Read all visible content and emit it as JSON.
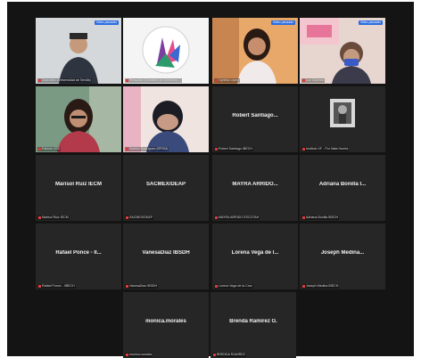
{
  "tiles": [
    {
      "name": "",
      "label": "Juan Aleo (Universidad de Sevilla)",
      "tag": "Video pausado",
      "video": "man"
    },
    {
      "name": "",
      "label": "Personas (Comisión de Derechos...)",
      "tag": "",
      "video": "logo"
    },
    {
      "name": "",
      "label": "Cynthia López",
      "tag": "Video pausado",
      "video": "woman"
    },
    {
      "name": "",
      "label": "Luz Gabriela",
      "tag": "Video pausado",
      "video": "elder"
    },
    {
      "name": "",
      "label": "Fabiola CES",
      "tag": "",
      "video": "speaker"
    },
    {
      "name": "",
      "label": "Maribel Rodríguez (RPDM)",
      "tag": "",
      "video": "covering"
    },
    {
      "name": "Robert Santiago...",
      "label": "Robert Santiago IBECH",
      "tag": ""
    },
    {
      "name": "",
      "label": "Instituto VF - Por Nata Huerta",
      "tag": "",
      "video": "photo"
    },
    {
      "name": "Marisol Ruiz IECM",
      "label": "Marisol Ruiz IECM",
      "tag": ""
    },
    {
      "name": "SACMEX/DEAP",
      "label": "SACMEX/DEAP",
      "tag": ""
    },
    {
      "name": "MAYRA ARRIDO...",
      "label": "MAYRA ARRIDO ESCOTAH",
      "tag": ""
    },
    {
      "name": "Adriana Bonilla I...",
      "label": "Adriana Bonilla IBECH",
      "tag": ""
    },
    {
      "name": "Rafael Ponce - II...",
      "label": "Rafael Ponce - IIBECH",
      "tag": ""
    },
    {
      "name": "VanesaDiaz IBSDH",
      "label": "VanesaDiaz IBSDH",
      "tag": ""
    },
    {
      "name": "Lorena Vega de l...",
      "label": "Lorena Vega de la Cruz",
      "tag": ""
    },
    {
      "name": "Joseph Medina...",
      "label": "Joseph Medina IBECH",
      "tag": ""
    },
    {
      "name": "monica.morales",
      "label": "monica.morales",
      "tag": ""
    },
    {
      "name": "Brenda Ramírez G.",
      "label": "BRENDA RAMIREZ",
      "tag": ""
    }
  ],
  "active_index": 4,
  "colors": {
    "background": "#141414",
    "tile": "#262626",
    "active_border": "#c9d64a",
    "muted_mic": "#e03b3b"
  }
}
